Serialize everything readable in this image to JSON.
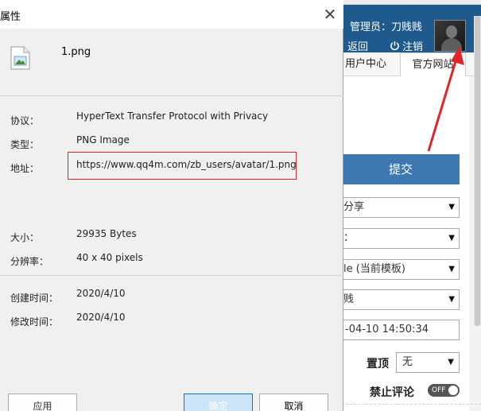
{
  "admin_page": {
    "admin_label": "管理员：刀贱贱",
    "back_label": "返回",
    "logout_label": "注销",
    "tabs": [
      {
        "label": "用户中心"
      },
      {
        "label": "官方网站"
      }
    ],
    "submit_label": "提交",
    "selects": [
      {
        "value": "分享"
      },
      {
        "value": "："
      },
      {
        "value": "le (当前模板)"
      },
      {
        "value": "贱"
      }
    ],
    "datetime_value": "-04-10 14:50:34",
    "pin_label": "置顶",
    "pin_value": "无",
    "disable_comment_label": "禁止评论",
    "toggle_label": "OFF"
  },
  "dialog": {
    "title": "属性",
    "file_name": "1.png",
    "fields": {
      "protocol_label": "协议：",
      "protocol_value": "HyperText Transfer Protocol with Privacy",
      "type_label": "类型：",
      "type_value": "PNG Image",
      "address_label": "地址：",
      "address_value": "https://www.qq4m.com/zb_users/avatar/1.png",
      "size_label": "大小：",
      "size_value": "29935 Bytes",
      "resolution_label": "分辨率：",
      "resolution_value": "40 x 40 pixels",
      "created_label": "创建时间：",
      "created_value": "2020/4/10",
      "modified_label": "修改时间：",
      "modified_value": "2020/4/10"
    },
    "buttons": {
      "apply": "应用",
      "ok": "确定",
      "cancel": "取消"
    }
  },
  "colors": {
    "header_blue": "#1f5a8f",
    "submit_blue": "#3d78b1",
    "annotation_red": "#e0252a"
  },
  "icons": {
    "file": "file-image-icon",
    "close": "close-icon",
    "power": "power-icon"
  }
}
